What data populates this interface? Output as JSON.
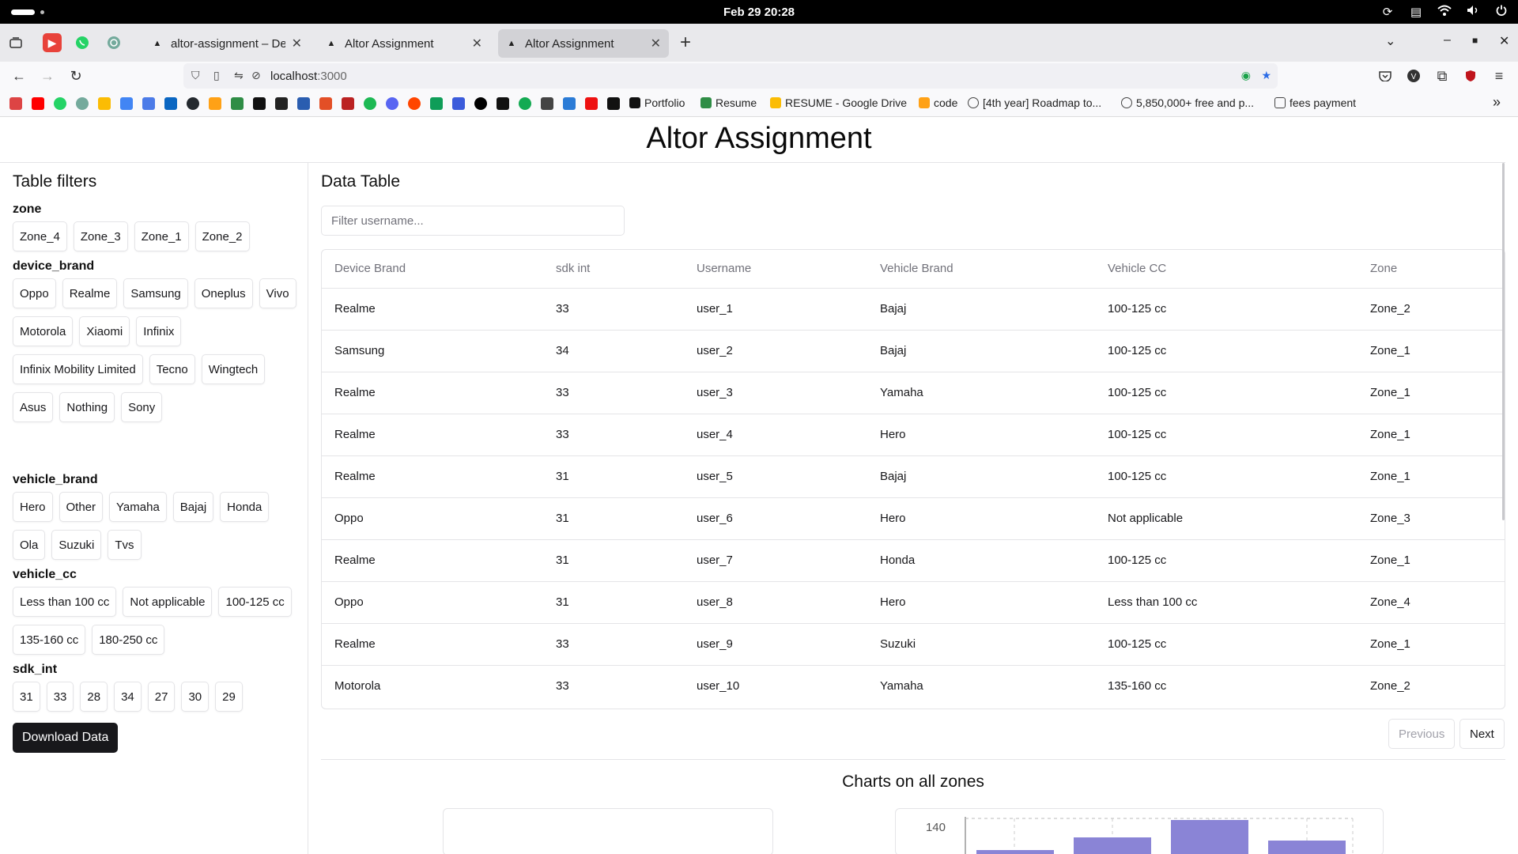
{
  "os": {
    "clock": "Feb 29  20:28"
  },
  "browser": {
    "tabs": [
      {
        "title": "altor-assignment – Deplo"
      },
      {
        "title": "Altor Assignment"
      },
      {
        "title": "Altor Assignment"
      }
    ],
    "url_host": "localhost",
    "url_port": ":3000",
    "bookmarks": [
      {
        "label": "Portfolio"
      },
      {
        "label": "Resume"
      },
      {
        "label": "RESUME - Google Drive"
      },
      {
        "label": "code"
      },
      {
        "label": "[4th year] Roadmap to..."
      },
      {
        "label": "5,850,000+ free and p..."
      },
      {
        "label": "fees payment"
      }
    ]
  },
  "page": {
    "title": "Altor Assignment"
  },
  "filters": {
    "title": "Table filters",
    "groups": [
      {
        "label": "zone",
        "options": [
          "Zone_4",
          "Zone_3",
          "Zone_1",
          "Zone_2"
        ]
      },
      {
        "label": "device_brand",
        "options": [
          "Oppo",
          "Realme",
          "Samsung",
          "Oneplus",
          "Vivo",
          "Motorola",
          "Xiaomi",
          "Infinix",
          "Infinix Mobility Limited",
          "Tecno",
          "Wingtech",
          "Asus",
          "Nothing",
          "Sony"
        ]
      },
      {
        "label": "vehicle_brand",
        "options": [
          "Hero",
          "Other",
          "Yamaha",
          "Bajaj",
          "Honda",
          "Ola",
          "Suzuki",
          "Tvs"
        ]
      },
      {
        "label": "vehicle_cc",
        "options": [
          "Less than 100 cc",
          "Not applicable",
          "100-125 cc",
          "135-160 cc",
          "180-250 cc"
        ]
      },
      {
        "label": "sdk_int",
        "options": [
          "31",
          "33",
          "28",
          "34",
          "27",
          "30",
          "29"
        ]
      }
    ],
    "download_label": "Download Data"
  },
  "table": {
    "title": "Data Table",
    "filter_placeholder": "Filter username...",
    "columns": [
      "Device Brand",
      "sdk int",
      "Username",
      "Vehicle Brand",
      "Vehicle CC",
      "Zone"
    ],
    "rows": [
      [
        "Realme",
        "33",
        "user_1",
        "Bajaj",
        "100-125 cc",
        "Zone_2"
      ],
      [
        "Samsung",
        "34",
        "user_2",
        "Bajaj",
        "100-125 cc",
        "Zone_1"
      ],
      [
        "Realme",
        "33",
        "user_3",
        "Yamaha",
        "100-125 cc",
        "Zone_1"
      ],
      [
        "Realme",
        "33",
        "user_4",
        "Hero",
        "100-125 cc",
        "Zone_1"
      ],
      [
        "Realme",
        "31",
        "user_5",
        "Bajaj",
        "100-125 cc",
        "Zone_1"
      ],
      [
        "Oppo",
        "31",
        "user_6",
        "Hero",
        "Not applicable",
        "Zone_3"
      ],
      [
        "Realme",
        "31",
        "user_7",
        "Honda",
        "100-125 cc",
        "Zone_1"
      ],
      [
        "Oppo",
        "31",
        "user_8",
        "Hero",
        "Less than 100 cc",
        "Zone_4"
      ],
      [
        "Realme",
        "33",
        "user_9",
        "Suzuki",
        "100-125 cc",
        "Zone_1"
      ],
      [
        "Motorola",
        "33",
        "user_10",
        "Yamaha",
        "135-160 cc",
        "Zone_2"
      ]
    ],
    "prev_label": "Previous",
    "next_label": "Next"
  },
  "charts": {
    "title": "Charts on all zones",
    "bar_color": "#8a84d6",
    "y_tick": "140"
  }
}
